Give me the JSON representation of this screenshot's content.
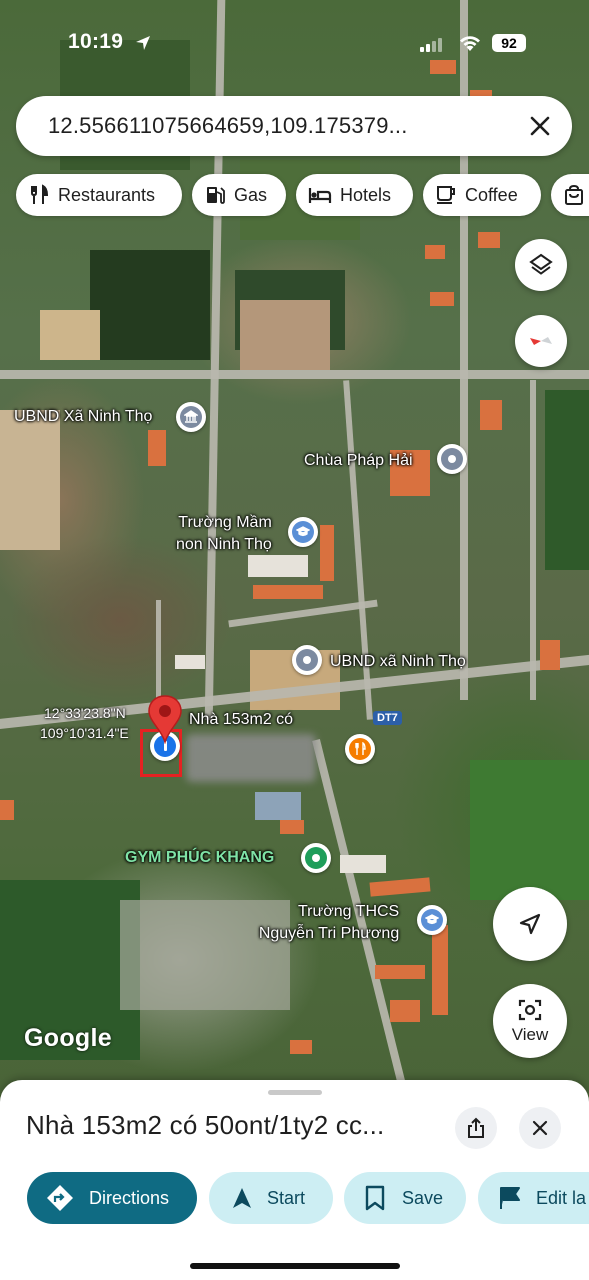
{
  "status_bar": {
    "time": "10:19",
    "battery": "92"
  },
  "search": {
    "query": "12.556611075664659,109.175379..."
  },
  "chips": [
    {
      "label": "Restaurants",
      "icon": "restaurant-icon"
    },
    {
      "label": "Gas",
      "icon": "gas-icon"
    },
    {
      "label": "Hotels",
      "icon": "hotel-icon"
    },
    {
      "label": "Coffee",
      "icon": "coffee-icon"
    },
    {
      "label": "",
      "icon": "shopping-icon"
    }
  ],
  "map": {
    "pois": [
      {
        "name": "UBND Xã Ninh Thọ",
        "icon": "government-icon"
      },
      {
        "name": "Chùa Pháp Hải",
        "icon": "place-icon"
      },
      {
        "name_line1": "Trường Mầm",
        "name_line2": "non Ninh Thọ",
        "icon": "school-icon"
      },
      {
        "name": "UBND xã Ninh Thọ",
        "icon": "place-icon"
      },
      {
        "name": "GYM PHÚC KHANG",
        "icon": "gym-icon"
      },
      {
        "name_line1": "Trường THCS",
        "name_line2": "Nguyễn Tri Phương",
        "icon": "school-icon"
      }
    ],
    "dropped_pin": {
      "lat_label": "12°33'23.8\"N",
      "lng_label": "109°10'31.4\"E",
      "place_label": "Nhà 153m2 có"
    },
    "road_badge": "DT7",
    "attribution": "Google",
    "view_button_label": "View",
    "colors": {
      "pin_red": "#e53935",
      "school_blue": "#5a8fd6",
      "gym_green": "#1e9e5a",
      "food_orange": "#f57c00"
    }
  },
  "place_sheet": {
    "title": "Nhà 153m2 có 50ont/1ty2 cc...",
    "actions": [
      {
        "label": "Directions",
        "icon": "directions-icon"
      },
      {
        "label": "Start",
        "icon": "navigation-icon"
      },
      {
        "label": "Save",
        "icon": "bookmark-icon"
      },
      {
        "label": "Edit la",
        "icon": "flag-icon"
      }
    ]
  }
}
